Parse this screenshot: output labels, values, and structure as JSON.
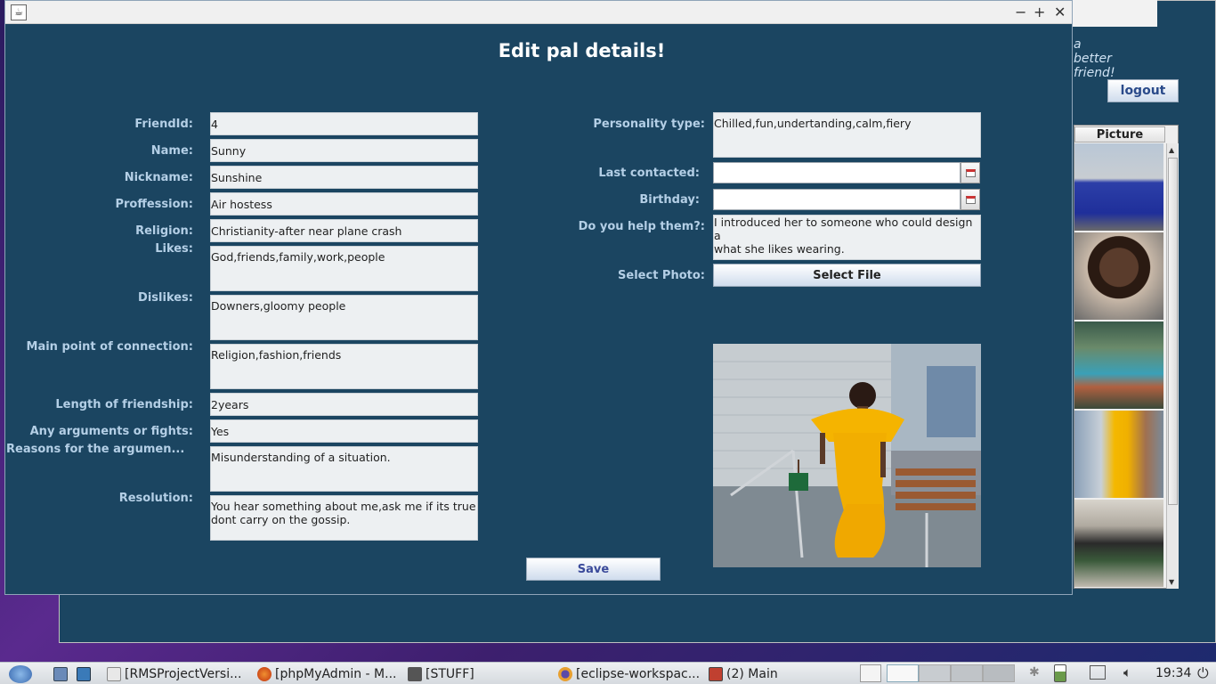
{
  "background_window": {
    "tagline": "a better friend!",
    "logout_label": "logout",
    "picture_column_header": "Picture",
    "controls": {
      "minimize": "−",
      "maximize": "+"
    }
  },
  "dialog": {
    "title": "Edit pal details!",
    "controls": {
      "minimize": "−",
      "maximize": "+",
      "close": "✕"
    },
    "left_fields": [
      {
        "label": "FriendId:",
        "value": "4"
      },
      {
        "label": "Name:",
        "value": "Sunny"
      },
      {
        "label": "Nickname:",
        "value": "Sunshine"
      },
      {
        "label": "Proffession:",
        "value": "Air hostess"
      },
      {
        "label": "Religion:",
        "value": "Christianity-after near plane crash"
      },
      {
        "label": "Likes:",
        "value": "God,friends,family,work,people"
      },
      {
        "label": "Dislikes:",
        "value": "Downers,gloomy people"
      },
      {
        "label": "Main point of connection:",
        "value": "Religion,fashion,friends"
      },
      {
        "label": "Length of friendship:",
        "value": "2years"
      },
      {
        "label": "Any arguments or fights:",
        "value": "Yes"
      },
      {
        "label": "Reasons for the argumen...",
        "value": "Misunderstanding of a situation."
      },
      {
        "label": "Resolution:",
        "value": "You hear something about me,ask me if its true\ndont carry on the gossip."
      }
    ],
    "right_fields": {
      "personality": {
        "label": "Personality type:",
        "value": "Chilled,fun,undertanding,calm,fiery"
      },
      "last_contacted": {
        "label": "Last contacted:",
        "value": ""
      },
      "birthday": {
        "label": "Birthday:",
        "value": ""
      },
      "help": {
        "label": "Do you help them?:",
        "value": "I introduced her to someone who could design a\nwhat she likes wearing."
      },
      "photo": {
        "label": "Select Photo:",
        "button": "Select File"
      }
    },
    "save_label": "Save"
  },
  "taskbar": {
    "items": [
      {
        "label": "[RMSProjectVersi..."
      },
      {
        "label": "[phpMyAdmin - M..."
      },
      {
        "label": "[STUFF]"
      },
      {
        "label": "[eclipse-workspac..."
      },
      {
        "label": "(2) Main"
      }
    ],
    "clock": "19:34"
  },
  "colors": {
    "window_bg": "#1b4561",
    "label_color": "#b4cfe6",
    "field_bg": "#edf0f2"
  }
}
